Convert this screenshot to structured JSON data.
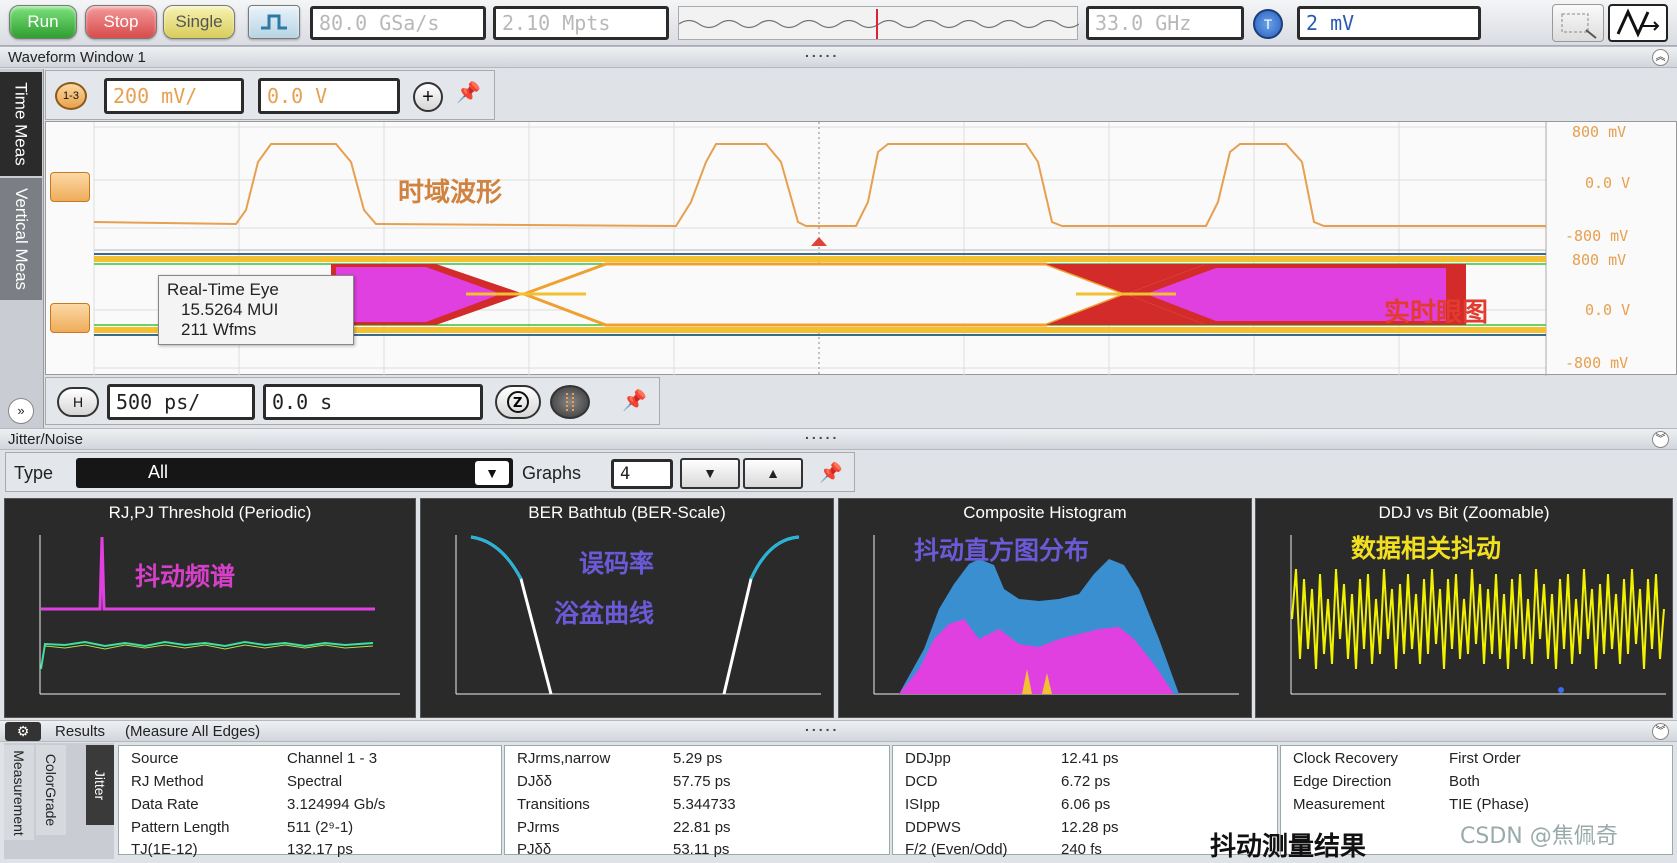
{
  "toolbar": {
    "run": "Run",
    "stop": "Stop",
    "single": "Single",
    "sample_rate": "80.0 GSa/s",
    "memory": "2.10 Mpts",
    "bandwidth": "33.0 GHz",
    "trigger_badge": "T",
    "trigger_level": "2 mV"
  },
  "waveform_window": {
    "title": "Waveform Window 1",
    "channel_badge": "1-3",
    "scale": "200 mV/",
    "offset": "0.0 V",
    "top_labels": [
      "800 mV",
      "0.0 V",
      "-800 mV"
    ],
    "bottom_labels": [
      "800 mV",
      "0.0 V",
      "-800 mV"
    ],
    "time_domain_annotation": "时域波形",
    "eye_info": {
      "title": "Real-Time Eye",
      "mui": "15.5264 MUI",
      "wfms": "211 Wfms"
    },
    "eye_annotation": "实时眼图",
    "timebase_badge": "H",
    "timebase": "500 ps/",
    "time_offset": "0.0 s"
  },
  "side_tabs": [
    "Time Meas",
    "Vertical Meas"
  ],
  "jitter": {
    "title": "Jitter/Noise",
    "type_label": "Type",
    "type_value": "All",
    "graphs_label": "Graphs",
    "graphs_value": "4",
    "panels": [
      {
        "title": "RJ,PJ Threshold (Periodic)",
        "note": "抖动频谱"
      },
      {
        "title": "BER Bathtub (BER-Scale)",
        "note1": "误码率",
        "note2": "浴盆曲线"
      },
      {
        "title": "Composite Histogram",
        "note": "抖动直方图分布"
      },
      {
        "title": "DDJ vs Bit (Zoomable)",
        "note": "数据相关抖动"
      }
    ]
  },
  "results": {
    "title": "Results",
    "subtitle": "(Measure All Edges)",
    "side_tabs": [
      "Measurement",
      "ColorGrade",
      "Jitter"
    ],
    "col1": [
      {
        "k": "Source",
        "v": "Channel 1 - 3"
      },
      {
        "k": "RJ Method",
        "v": "Spectral"
      },
      {
        "k": "Data Rate",
        "v": "3.124994 Gb/s"
      },
      {
        "k": "Pattern Length",
        "v": "511 (2⁹-1)"
      },
      {
        "k": "TJ(1E-12)",
        "v": "132.17 ps"
      }
    ],
    "col2": [
      {
        "k": "RJrms,narrow",
        "v": "5.29 ps"
      },
      {
        "k": "DJδδ",
        "v": "57.75 ps"
      },
      {
        "k": "Transitions",
        "v": "5.344733"
      },
      {
        "k": "PJrms",
        "v": "22.81 ps"
      },
      {
        "k": "PJδδ",
        "v": "53.11 ps"
      }
    ],
    "col3": [
      {
        "k": "DDJpp",
        "v": "12.41 ps"
      },
      {
        "k": "DCD",
        "v": "6.72 ps"
      },
      {
        "k": "ISIpp",
        "v": "6.06 ps"
      },
      {
        "k": "DDPWS",
        "v": "12.28 ps"
      },
      {
        "k": "F/2 (Even/Odd)",
        "v": "240 fs"
      }
    ],
    "col4": [
      {
        "k": "Clock Recovery",
        "v": "First Order"
      },
      {
        "k": "Edge Direction",
        "v": "Both"
      },
      {
        "k": "Measurement",
        "v": "TIE (Phase)"
      }
    ],
    "annotation": "抖动测量结果",
    "watermark": "CSDN @焦佩奇"
  },
  "colors": {
    "run": "#3fb43f",
    "stop": "#e05050",
    "single": "#e8de72",
    "trace": "#e6a050",
    "magenta": "#e040e0",
    "yellow": "#f2f200"
  }
}
